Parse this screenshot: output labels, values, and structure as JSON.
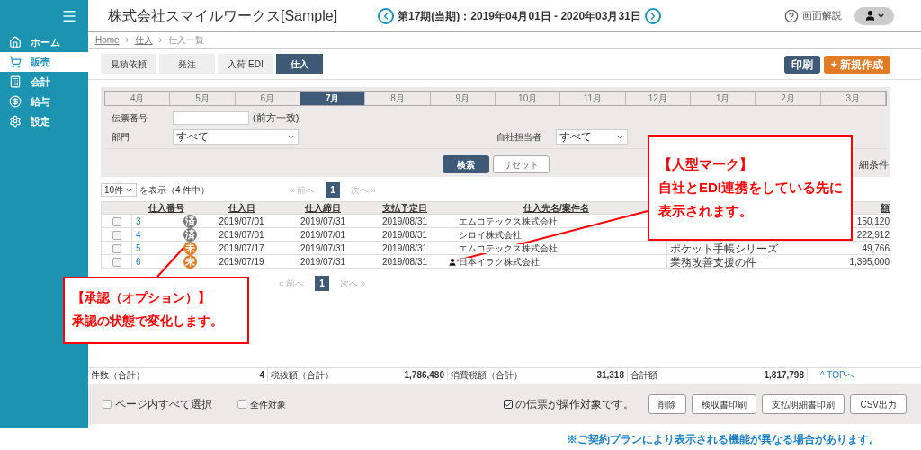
{
  "sidebar": {
    "items": [
      {
        "label": "ホーム",
        "selected": false
      },
      {
        "label": "販売",
        "selected": true
      },
      {
        "label": "会計",
        "selected": false
      },
      {
        "label": "給与",
        "selected": false
      },
      {
        "label": "設定",
        "selected": false
      }
    ]
  },
  "header": {
    "title": "株式会社スマイルワークス[Sample]",
    "period": "第17期(当期)：2019年04月01日 - 2020年03月31日",
    "help": "画面解説"
  },
  "breadcrumb": [
    {
      "label": "Home",
      "link": true
    },
    {
      "label": "仕入",
      "link": true
    },
    {
      "label": "仕入一覧",
      "link": false
    }
  ],
  "tabs": [
    {
      "label": "見積依頼",
      "selected": false
    },
    {
      "label": "発注",
      "selected": false
    },
    {
      "label": "入荷 EDI",
      "selected": false
    },
    {
      "label": "仕入",
      "selected": true
    }
  ],
  "actions": [
    {
      "label": "印刷",
      "kind": "secondary"
    },
    {
      "label": "+ 新規作成",
      "kind": "primary"
    }
  ],
  "months": [
    {
      "label": "4月",
      "selected": false
    },
    {
      "label": "5月",
      "selected": false
    },
    {
      "label": "6月",
      "selected": false
    },
    {
      "label": "7月",
      "selected": true
    },
    {
      "label": "8月",
      "selected": false
    },
    {
      "label": "9月",
      "selected": false
    },
    {
      "label": "10月",
      "selected": false
    },
    {
      "label": "11月",
      "selected": false
    },
    {
      "label": "12月",
      "selected": false
    },
    {
      "label": "1月",
      "selected": false
    },
    {
      "label": "2月",
      "selected": false
    },
    {
      "label": "3月",
      "selected": false
    }
  ],
  "filters": {
    "slip_label": "伝票番号",
    "slip_hint": "(前方一致)",
    "dept_label": "部門",
    "dept_value": "すべて",
    "staff_label": "自社担当者",
    "staff_value": "すべて",
    "search": "検索",
    "reset": "リセット",
    "more": "細条件"
  },
  "page_size": {
    "value": "10件",
    "text": "を表示（4 件中）"
  },
  "pagers": [
    {
      "prev": "« 前へ",
      "page": "1",
      "next": "次へ »"
    },
    {
      "prev": "« 前へ",
      "page": "1",
      "next": "次へ »"
    }
  ],
  "table": {
    "columns": [
      "仕入番号",
      "仕入日",
      "仕入締日",
      "支払予定日",
      "仕入先名/案件名",
      "",
      "額"
    ],
    "rows": [
      {
        "checked": false,
        "no": "3",
        "approved": true,
        "badge": "済",
        "date": "2019/07/01",
        "close": "2019/07/31",
        "pay": "2019/08/31",
        "edi_linked": false,
        "supplier": "エムコテックス株式会社",
        "project": "",
        "amount": "150,120"
      },
      {
        "checked": false,
        "no": "4",
        "approved": true,
        "badge": "済",
        "date": "2019/07/01",
        "close": "2019/07/01",
        "pay": "2019/08/31",
        "edi_linked": false,
        "supplier": "シロイ株式会社",
        "project": "",
        "amount": "222,912"
      },
      {
        "checked": false,
        "no": "5",
        "approved": false,
        "badge": "未",
        "date": "2019/07/17",
        "close": "2019/07/31",
        "pay": "2019/08/31",
        "edi_linked": false,
        "supplier": "エムコテックス株式会社",
        "project": "ポケット手帳シリーズ",
        "amount": "49,766"
      },
      {
        "checked": false,
        "no": "6",
        "approved": false,
        "badge": "未",
        "date": "2019/07/19",
        "close": "2019/07/31",
        "pay": "2019/08/31",
        "edi_linked": true,
        "supplier": "日本イラク株式会社",
        "project": "業務改善支援の件",
        "amount": "1,395,000"
      }
    ]
  },
  "totals": [
    {
      "label": "件数（合計）",
      "value": "4"
    },
    {
      "label": "税抜額（合計）",
      "value": "1,786,480"
    },
    {
      "label": "消費税額（合計）",
      "value": "31,318"
    },
    {
      "label": "合計額",
      "value": "1,817,798"
    }
  ],
  "top_link": "^ TOPへ",
  "bottom": {
    "select_page": {
      "label": "ページ内すべて選択",
      "checked": false
    },
    "select_all": {
      "label": "全件対象",
      "checked": false
    },
    "target_note": {
      "label": "の伝票が操作対象です。",
      "checked": true
    },
    "buttons": [
      "削除",
      "検収書印刷",
      "支払明細書印刷",
      "CSV出力"
    ]
  },
  "note": "※ご契約プランにより表示される機能が異なる場合があります。",
  "annotations": [
    {
      "title": "【人型マーク】",
      "body": "自社とEDI連携をしている先に表示されます。"
    },
    {
      "title": "【承認（オプション）】",
      "body": "承認の状態で変化します。"
    }
  ]
}
